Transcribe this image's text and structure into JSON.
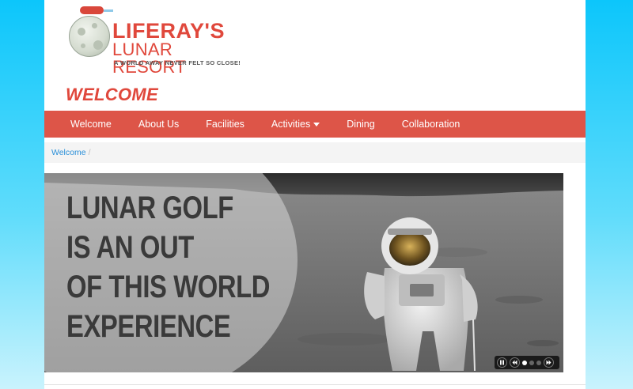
{
  "logo": {
    "line1": "LIFERAY'S",
    "line2": "LUNAR RESORT",
    "tagline": "A WORLD AWAY NEVER FELT SO CLOSE!"
  },
  "page_title": "WELCOME",
  "nav": {
    "items": [
      {
        "label": "Welcome"
      },
      {
        "label": "About Us"
      },
      {
        "label": "Facilities"
      },
      {
        "label": "Activities",
        "has_dropdown": true
      },
      {
        "label": "Dining"
      },
      {
        "label": "Collaboration"
      }
    ]
  },
  "breadcrumb": {
    "items": [
      "Welcome"
    ],
    "separator": "/"
  },
  "banner": {
    "lines": [
      "LUNAR GOLF",
      "IS AN OUT",
      "OF THIS WORLD",
      "EXPERIENCE"
    ],
    "slides_total": 3,
    "active_slide": 1
  },
  "colors": {
    "brand_red": "#dd5548",
    "title_red": "#e0483c",
    "link_blue": "#2a8fd8",
    "sky_gradient_top": "#0cc6fb"
  },
  "icons": {
    "pause": "pause-icon",
    "prev": "rewind-icon",
    "next": "fast-forward-icon",
    "dropdown": "caret-down-icon"
  }
}
